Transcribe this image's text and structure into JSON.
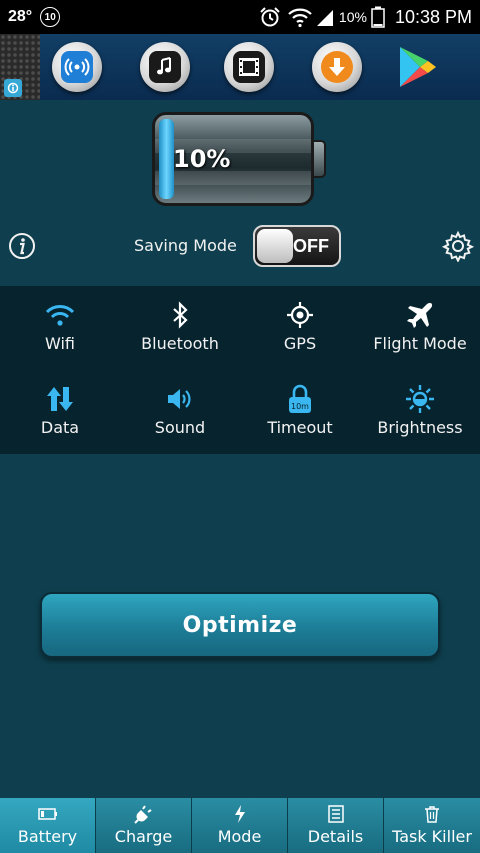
{
  "status_bar": {
    "temperature": "28°",
    "notification_count": "10",
    "battery_percent": "10%",
    "time": "10:38 PM"
  },
  "ad_banner": {
    "icons": [
      "wifi-hotspot-icon",
      "music-icon",
      "video-icon",
      "download-icon",
      "play-store-icon"
    ]
  },
  "battery": {
    "percent_label": "10%",
    "level": 0.1
  },
  "saving_mode": {
    "label": "Saving Mode",
    "toggle_state": "OFF"
  },
  "quick_settings": [
    {
      "label": "Wifi",
      "icon": "wifi-icon"
    },
    {
      "label": "Bluetooth",
      "icon": "bluetooth-icon"
    },
    {
      "label": "GPS",
      "icon": "gps-icon"
    },
    {
      "label": "Flight Mode",
      "icon": "airplane-icon"
    },
    {
      "label": "Data",
      "icon": "data-icon"
    },
    {
      "label": "Sound",
      "icon": "sound-icon"
    },
    {
      "label": "Timeout",
      "icon": "timeout-lock-icon",
      "badge": "10m"
    },
    {
      "label": "Brightness",
      "icon": "brightness-icon"
    }
  ],
  "optimize_button": "Optimize",
  "bottom_nav": [
    {
      "label": "Battery",
      "icon": "battery-icon",
      "active": true
    },
    {
      "label": "Charge",
      "icon": "plug-icon"
    },
    {
      "label": "Mode",
      "icon": "lightning-icon"
    },
    {
      "label": "Details",
      "icon": "list-icon"
    },
    {
      "label": "Task Killer",
      "icon": "trash-icon"
    }
  ],
  "colors": {
    "background": "#0f3f4e",
    "accent_blue": "#3ab6f0",
    "nav_bar": "#1f7f93"
  }
}
